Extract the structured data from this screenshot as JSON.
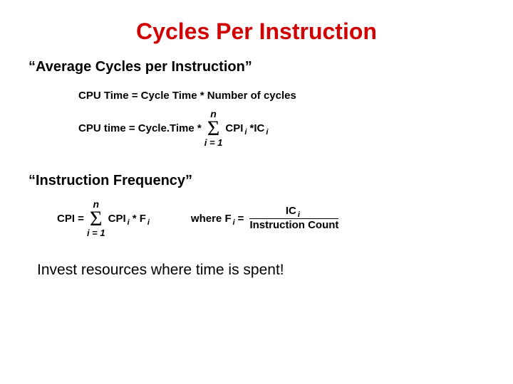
{
  "title": "Cycles Per Instruction",
  "heading1": "“Average Cycles per Instruction”",
  "eq1": "CPU Time = Cycle Time * Number of cycles",
  "eq2": {
    "lhs": "CPU time = Cycle.Time *",
    "sigma_top": "n",
    "sigma_sym": "Σ",
    "sigma_bot": "i  = 1",
    "cpi": "CPI",
    "sub_i1": "i",
    "star": " * ",
    "ic": " IC",
    "sub_i2": "i"
  },
  "heading2": "“Instruction Frequency”",
  "eq3": {
    "lhs": "CPI  = ",
    "sigma_top": "n",
    "sigma_sym": "Σ",
    "sigma_bot": "i  = 1",
    "cpi": "CPI",
    "sub_i1": "i",
    "star": " *  F",
    "sub_i2": "i",
    "where": "where   F",
    "sub_i3": "i",
    "equals": "  = ",
    "frac_top_ic": "IC",
    "frac_top_sub": "i",
    "frac_bot": "Instruction Count"
  },
  "closing": "Invest resources where time is spent!"
}
